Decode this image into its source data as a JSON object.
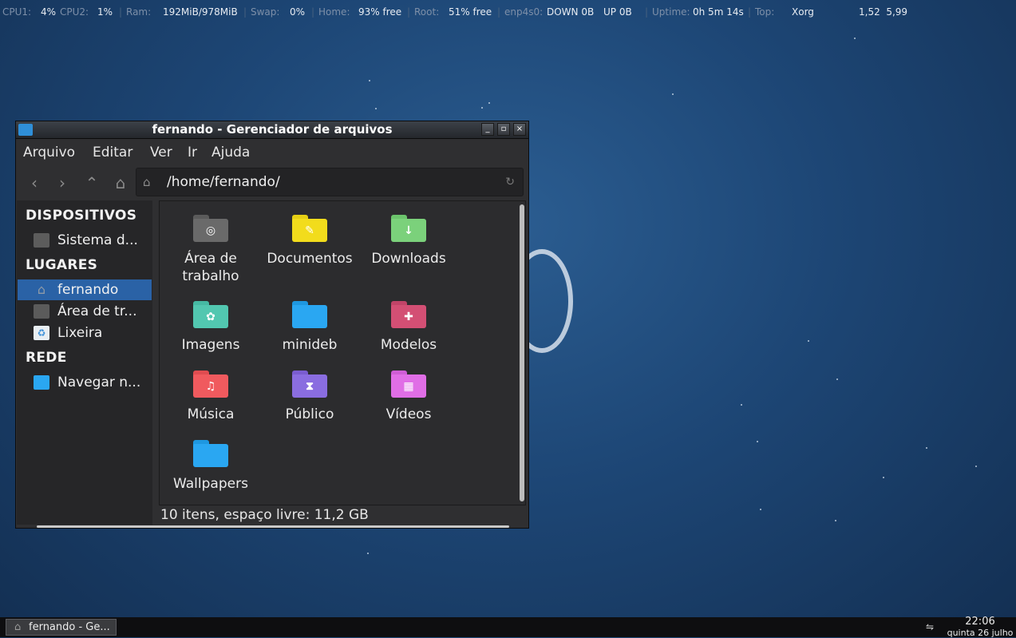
{
  "conky": {
    "cpu1_label": "CPU1:",
    "cpu1": "4%",
    "cpu2_label": "CPU2:",
    "cpu2": "1%",
    "ram_label": "Ram:",
    "ram": "192MiB/978MiB",
    "swap_label": "Swap:",
    "swap": "0%",
    "home_label": "Home:",
    "home": "93% free",
    "root_label": "Root:",
    "root": "51% free",
    "net_label": "enp4s0:",
    "down": "DOWN 0B",
    "up": "UP 0B",
    "uptime_label": "Uptime:",
    "uptime": "0h 5m 14s",
    "top_label": "Top:",
    "top_proc": "Xorg",
    "load": "1,52  5,99"
  },
  "window": {
    "title": "fernando - Gerenciador de arquivos",
    "buttons": {
      "minimize": "_",
      "maximize": "▫",
      "close": "×"
    }
  },
  "menubar": [
    "Arquivo",
    "Editar",
    "Ver",
    "Ir",
    "Ajuda"
  ],
  "toolbar": {
    "back_icon": "‹",
    "forward_icon": "›",
    "up_icon": "⌃",
    "home_icon": "⌂",
    "path": "/home/fernando/",
    "reload_icon": "↻"
  },
  "sidebar": {
    "devices_header": "DISPOSITIVOS",
    "devices": [
      {
        "label": "Sistema d...",
        "icon": "drive-icon"
      }
    ],
    "places_header": "LUGARES",
    "places": [
      {
        "label": "fernando",
        "icon": "home-icon",
        "selected": true
      },
      {
        "label": "Área de tr...",
        "icon": "desktop-folder-icon"
      },
      {
        "label": "Lixeira",
        "icon": "trash-icon"
      }
    ],
    "network_header": "REDE",
    "network": [
      {
        "label": "Navegar n...",
        "icon": "network-icon"
      }
    ]
  },
  "files": [
    {
      "name": "Área de trabalho",
      "color": "#5b5b5b",
      "symbol": "◎"
    },
    {
      "name": "Documentos",
      "color": "#f2dc1c",
      "symbol": "✎"
    },
    {
      "name": "Downloads",
      "color": "#7bd17b",
      "symbol": "↓"
    },
    {
      "name": "Imagens",
      "color": "#52c7b0",
      "symbol": "✿"
    },
    {
      "name": "minideb",
      "color": "#2aa7f2",
      "symbol": ""
    },
    {
      "name": "Modelos",
      "color": "#d34f74",
      "symbol": "✚"
    },
    {
      "name": "Música",
      "color": "#f05a5e",
      "symbol": "♫"
    },
    {
      "name": "Público",
      "color": "#8a6de0",
      "symbol": "⧗"
    },
    {
      "name": "Vídeos",
      "color": "#e06ee6",
      "symbol": "▦"
    },
    {
      "name": "Wallpapers",
      "color": "#2aa7f2",
      "symbol": ""
    }
  ],
  "status": "10 itens, espaço livre: 11,2 GB",
  "taskbar": {
    "task_label": "fernando - Ge...",
    "time": "22:06",
    "date": "quinta 26 julho"
  }
}
